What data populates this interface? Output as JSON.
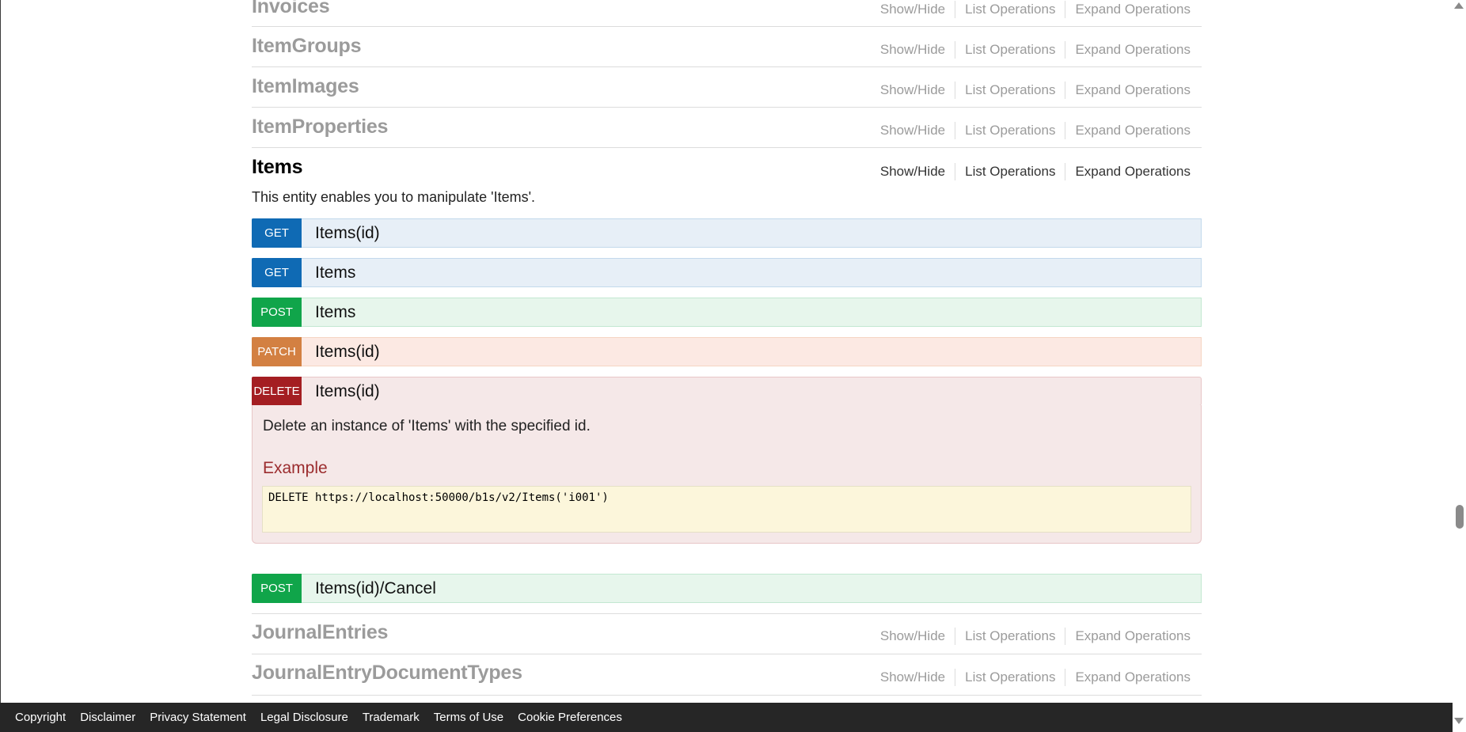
{
  "ops": {
    "show_hide": "Show/Hide",
    "list_operations": "List Operations",
    "expand_operations": "Expand Operations"
  },
  "resources_top": [
    {
      "name": "Invoices"
    },
    {
      "name": "ItemGroups"
    },
    {
      "name": "ItemImages"
    },
    {
      "name": "ItemProperties"
    }
  ],
  "active_resource": {
    "name": "Items",
    "description": "This entity enables you to manipulate 'Items'.",
    "endpoints": [
      {
        "verb": "GET",
        "path": "Items(id)"
      },
      {
        "verb": "GET",
        "path": "Items"
      },
      {
        "verb": "POST",
        "path": "Items"
      },
      {
        "verb": "PATCH",
        "path": "Items(id)"
      },
      {
        "verb": "DELETE",
        "path": "Items(id)"
      },
      {
        "verb": "POST",
        "path": "Items(id)/Cancel"
      }
    ],
    "delete_details": {
      "description": "Delete an instance of 'Items' with the specified id.",
      "example_heading": "Example",
      "example_code": "DELETE https://localhost:50000/b1s/v2/Items('i001')"
    }
  },
  "resources_bottom": [
    {
      "name": "JournalEntries"
    },
    {
      "name": "JournalEntryDocumentTypes"
    }
  ],
  "footer": {
    "links": [
      "Copyright",
      "Disclaimer",
      "Privacy Statement",
      "Legal Disclosure",
      "Trademark",
      "Terms of Use",
      "Cookie Preferences"
    ]
  },
  "colors": {
    "get": "#0f6ab4",
    "post": "#10a54a",
    "patch": "#d38042",
    "delete": "#a41e22",
    "footer_bg": "#262626"
  }
}
